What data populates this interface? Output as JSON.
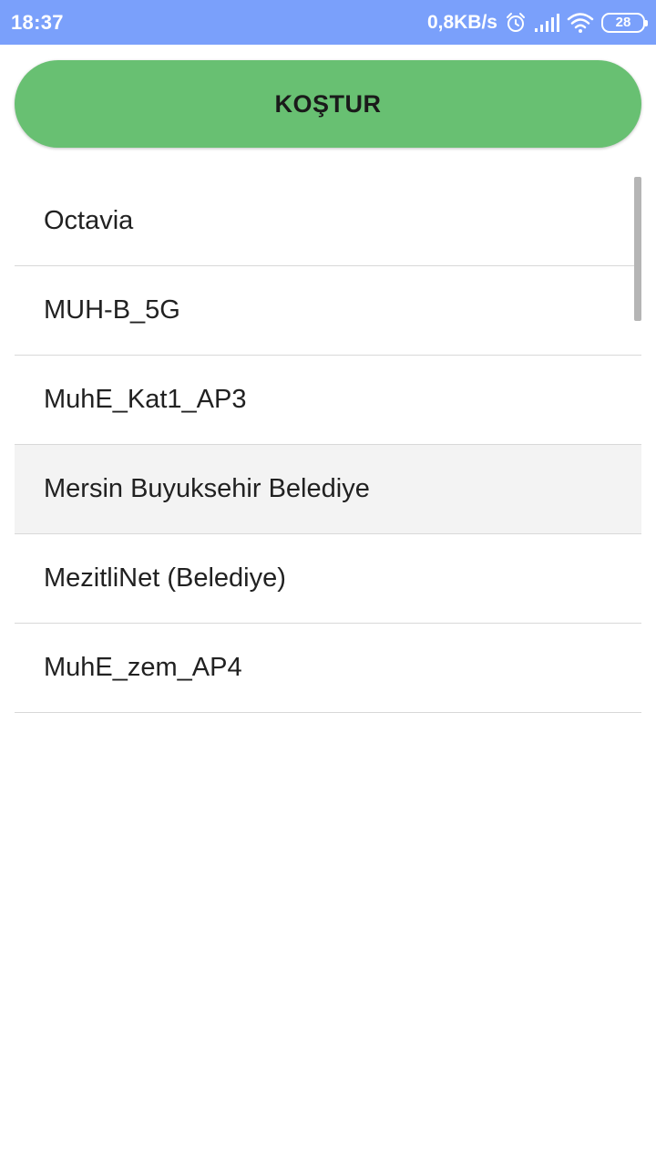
{
  "status_bar": {
    "time": "18:37",
    "net_speed": "0,8KB/s",
    "battery_level": "28",
    "icons": [
      "alarm-icon",
      "signal-icon",
      "wifi-icon",
      "battery-icon"
    ],
    "background_color": "#7aa0fb"
  },
  "toolbar": {
    "run_label": "KOŞTUR",
    "button_color": "#68c072"
  },
  "networks": [
    {
      "label": "Octavia"
    },
    {
      "label": "MUH-B_5G"
    },
    {
      "label": "MuhE_Kat1_AP3"
    },
    {
      "label": "Mersin Buyuksehir Belediye",
      "pressed": true
    },
    {
      "label": "MezitliNet (Belediye)"
    },
    {
      "label": "MuhE_zem_AP4"
    }
  ]
}
